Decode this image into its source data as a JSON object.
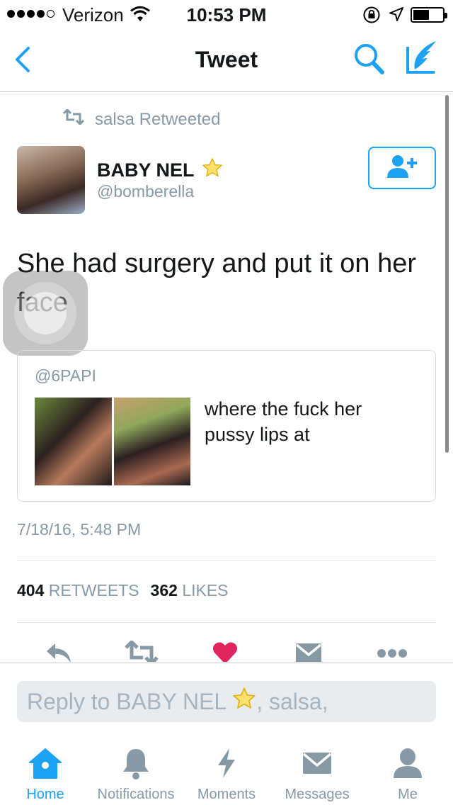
{
  "status_bar": {
    "carrier": "Verizon",
    "time": "10:53 PM",
    "signal_bars_filled": 4,
    "battery_level_percent": 50
  },
  "nav": {
    "title": "Tweet",
    "back_icon": "chevron-left-icon",
    "search_icon": "search-icon",
    "compose_icon": "compose-feather-icon"
  },
  "tweet": {
    "retweeted_by": "salsa Retweeted",
    "author_name": "BABY NEL",
    "author_handle": "@bomberella",
    "text": "She had surgery and put it on her face",
    "quoted": {
      "handle": "@6PAPI",
      "text": "where the fuck her pussy lips at"
    },
    "timestamp": "7/18/16, 5:48 PM",
    "retweets_count": "404",
    "retweets_label": "RETWEETS",
    "likes_count": "362",
    "likes_label": "LIKES",
    "liked": true
  },
  "reply": {
    "placeholder_prefix": "Reply to BABY NEL",
    "placeholder_suffix": ", salsa,"
  },
  "tabs": [
    {
      "label": "Home",
      "icon": "home-icon",
      "active": true
    },
    {
      "label": "Notifications",
      "icon": "bell-icon",
      "active": false
    },
    {
      "label": "Moments",
      "icon": "lightning-icon",
      "active": false
    },
    {
      "label": "Messages",
      "icon": "envelope-icon",
      "active": false
    },
    {
      "label": "Me",
      "icon": "person-icon",
      "active": false
    }
  ],
  "colors": {
    "accent": "#1da1f2",
    "muted": "#8899a6",
    "like": "#e0245e",
    "star": "#f5c518"
  }
}
